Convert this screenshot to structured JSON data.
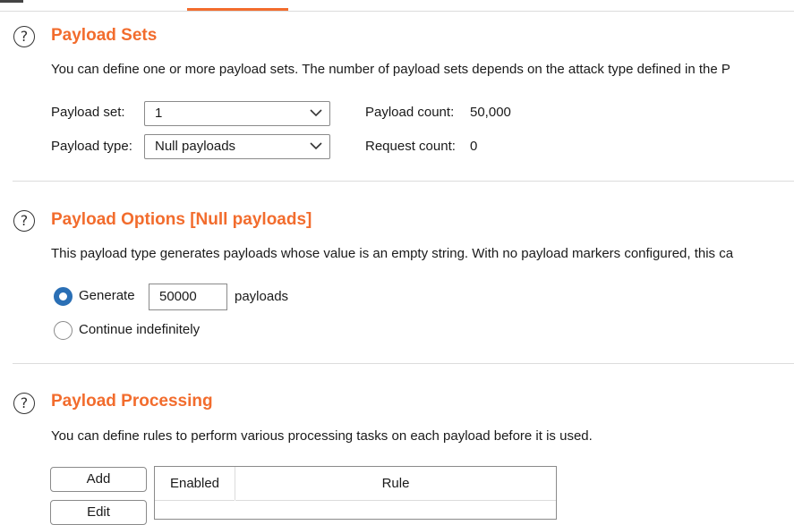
{
  "sections": {
    "payload_sets": {
      "title": "Payload Sets",
      "description": "You can define one or more payload sets. The number of payload sets depends on the attack type defined in the P",
      "payload_set_label": "Payload set:",
      "payload_set_value": "1",
      "payload_type_label": "Payload type:",
      "payload_type_value": "Null payloads",
      "payload_count_label": "Payload count:",
      "payload_count_value": "50,000",
      "request_count_label": "Request count:",
      "request_count_value": "0"
    },
    "payload_options": {
      "title": "Payload Options [Null payloads]",
      "description": "This payload type generates payloads whose value is an empty string. With no payload markers configured, this ca",
      "generate_label": "Generate",
      "generate_value": "50000",
      "payloads_suffix": "payloads",
      "continue_label": "Continue indefinitely",
      "selected": "generate"
    },
    "payload_processing": {
      "title": "Payload Processing",
      "description": "You can define rules to perform various processing tasks on each payload before it is used.",
      "add_label": "Add",
      "edit_label": "Edit",
      "table_headers": [
        "Enabled",
        "Rule"
      ]
    }
  },
  "colors": {
    "accent": "#f26c2d",
    "radio_selected": "#2a6fb5"
  },
  "icons": {
    "help": "?"
  }
}
